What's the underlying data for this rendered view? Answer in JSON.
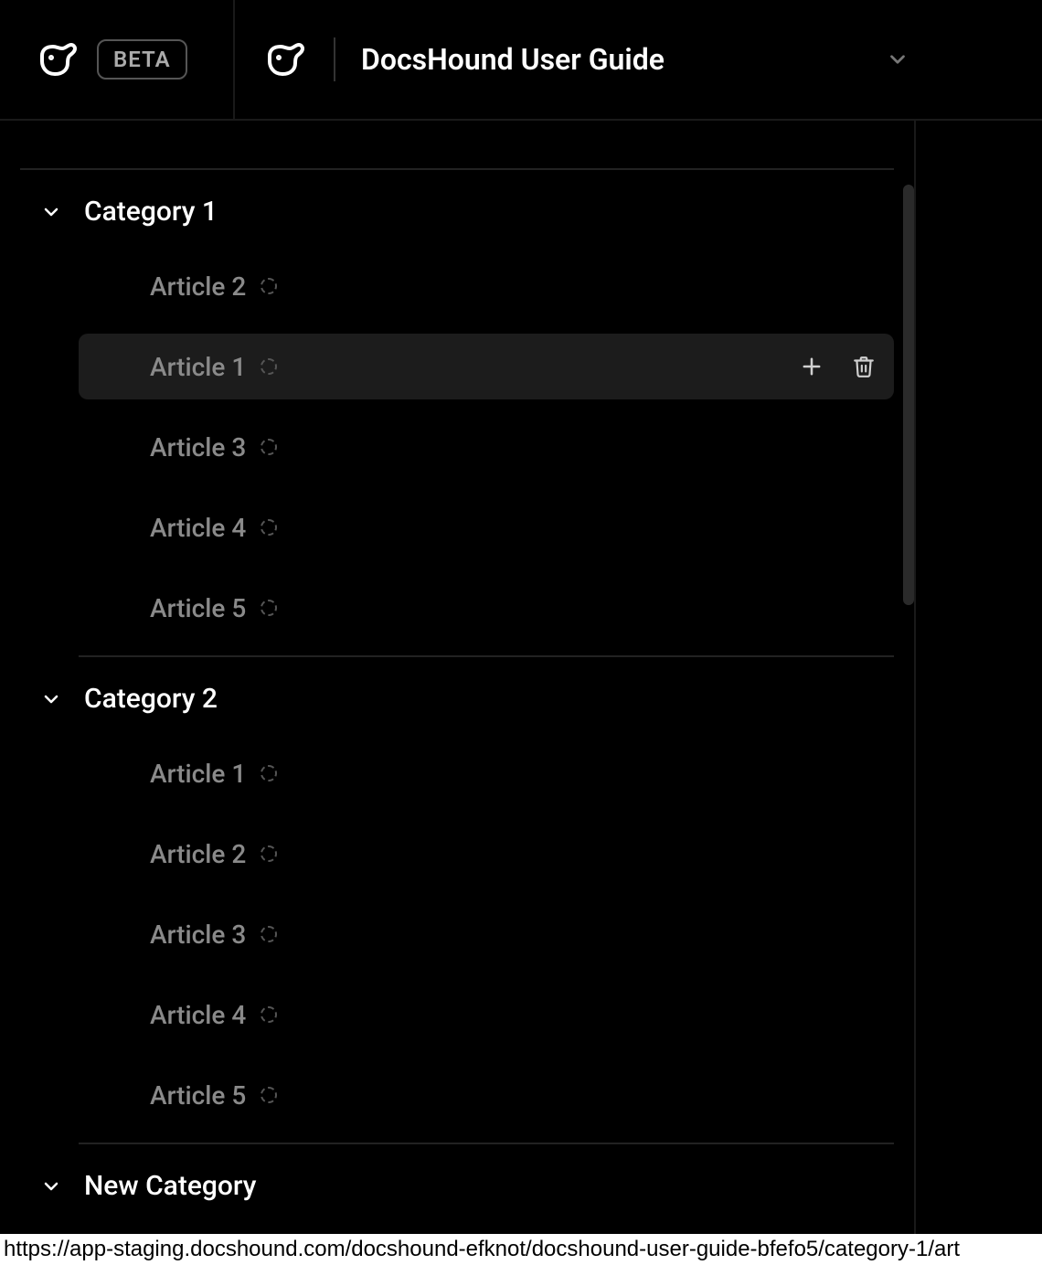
{
  "header": {
    "beta_label": "BETA",
    "guide_title": "DocsHound User Guide"
  },
  "sidebar": {
    "categories": [
      {
        "title": "Category 1",
        "articles": [
          {
            "title": "Article 2",
            "selected": false
          },
          {
            "title": "Article 1",
            "selected": true
          },
          {
            "title": "Article 3",
            "selected": false
          },
          {
            "title": "Article 4",
            "selected": false
          },
          {
            "title": "Article 5",
            "selected": false
          }
        ]
      },
      {
        "title": "Category 2",
        "articles": [
          {
            "title": "Article 1",
            "selected": false
          },
          {
            "title": "Article 2",
            "selected": false
          },
          {
            "title": "Article 3",
            "selected": false
          },
          {
            "title": "Article 4",
            "selected": false
          },
          {
            "title": "Article 5",
            "selected": false
          }
        ]
      },
      {
        "title": "New Category",
        "articles": []
      }
    ]
  },
  "statusbar": {
    "url": "https://app-staging.docshound.com/docshound-efknot/docshound-user-guide-bfefo5/category-1/art"
  }
}
